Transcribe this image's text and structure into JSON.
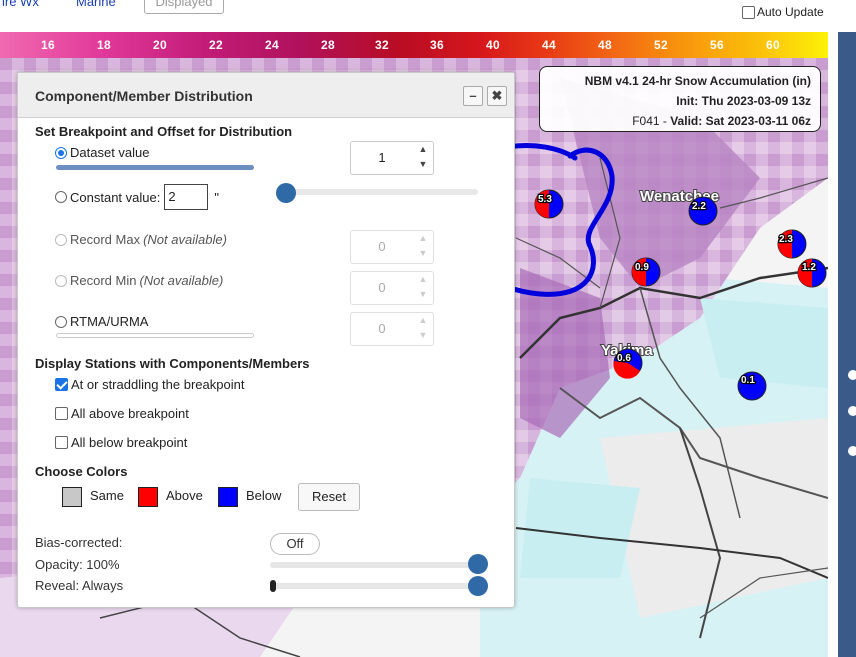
{
  "top": {
    "link1": "ire Wx",
    "link2": "Marine",
    "displayed_button": "Displayed",
    "auto_update_label": "Auto Update",
    "auto_update_checked": false
  },
  "scale": {
    "ticks": [
      "16",
      "18",
      "20",
      "22",
      "24",
      "28",
      "32",
      "36",
      "40",
      "44",
      "48",
      "52",
      "56",
      "60"
    ]
  },
  "info": {
    "title": "NBM v4.1 24-hr Snow Accumulation (in)",
    "init_label": "Init:",
    "init_value": "Thu 2023-03-09 13z",
    "forecast": "F041",
    "valid_label": "Valid:",
    "valid_value": "Sat 2023-03-11 06z"
  },
  "panel": {
    "title": "Component/Member Distribution",
    "minimize": "–",
    "close": "✖",
    "section1": "Set Breakpoint and Offset for Distribution",
    "options": {
      "dataset": "Dataset value",
      "constant": "Constant value:",
      "constant_value": "2",
      "constant_unit": "\"",
      "record_max": "Record Max",
      "record_min": "Record Min",
      "not_available": "(Not available)",
      "rtma": "RTMA/URMA"
    },
    "spinners": {
      "dataset": "1",
      "record_max": "0",
      "record_min": "0",
      "rtma": "0"
    },
    "section2": "Display Stations with Components/Members",
    "filters": {
      "straddle": "At or straddling the breakpoint",
      "above": "All above breakpoint",
      "below": "All below breakpoint"
    },
    "section3": "Choose Colors",
    "colors": {
      "same_label": "Same",
      "same_color": "#c8c8c8",
      "above_label": "Above",
      "above_color": "#ff0000",
      "below_label": "Below",
      "below_color": "#0000ff",
      "reset": "Reset"
    },
    "bias_label": "Bias-corrected:",
    "bias_toggle": "Off",
    "opacity_label": "Opacity: 100%",
    "opacity_value": 1.0,
    "reveal_label": "Reveal: Always"
  },
  "map": {
    "cities": [
      "Wenatchee",
      "Yakima"
    ],
    "stations": [
      "5.3",
      "2.2",
      "2.3",
      "1.2",
      "0.9",
      "0.6",
      "0.1"
    ]
  }
}
